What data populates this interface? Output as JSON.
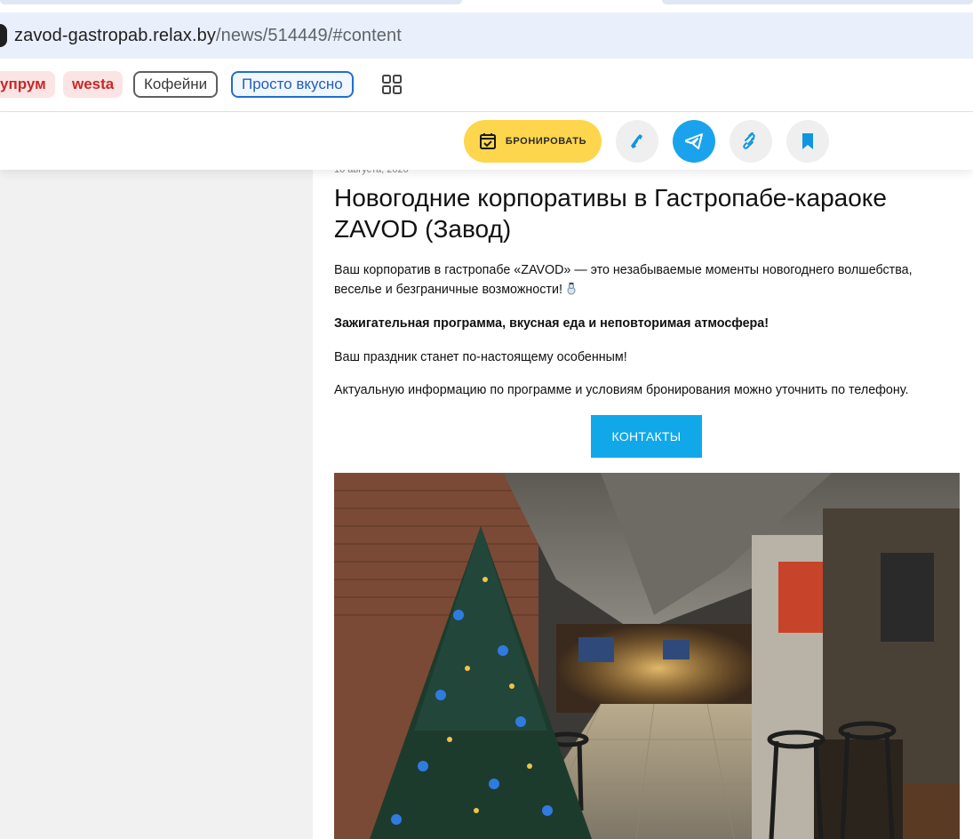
{
  "browser": {
    "url_host": "zavod-gastropab.relax.by",
    "url_path": "/news/514449/#content"
  },
  "bookmarks": {
    "items": [
      {
        "label": "упрум"
      },
      {
        "label": "westa"
      },
      {
        "label": "Кофейни"
      },
      {
        "label": "Просто вкусно"
      }
    ],
    "apps_icon": "grid-icon"
  },
  "action_bar": {
    "book_label": "БРОНИРОВАТЬ",
    "book_icon": "calendar-check-icon",
    "icons": [
      "phone-icon",
      "telegram-icon",
      "link-icon",
      "bookmark-icon"
    ],
    "accent_yellow": "#fdd64d",
    "accent_blue": "#1aa3ec"
  },
  "article": {
    "date": "10 августа, 2020",
    "title": "Новогодние корпоративы в Гастропабе-караоке ZAVOD (Завод)",
    "paragraphs": [
      "Ваш корпоратив в гастропабе «ZAVOD» — это незабываемые моменты новогоднего волшебства, веселье и безграничные возможности!",
      "Зажигательная программа, вкусная еда и неповторимая атмосфера!",
      "Ваш праздник станет по-настоящему особенным!",
      "Актуальную информацию по программе и условиям бронирования можно уточнить по телефону."
    ],
    "contacts_label": "КОНТАКТЫ",
    "photo_alt": "interior-photo"
  }
}
